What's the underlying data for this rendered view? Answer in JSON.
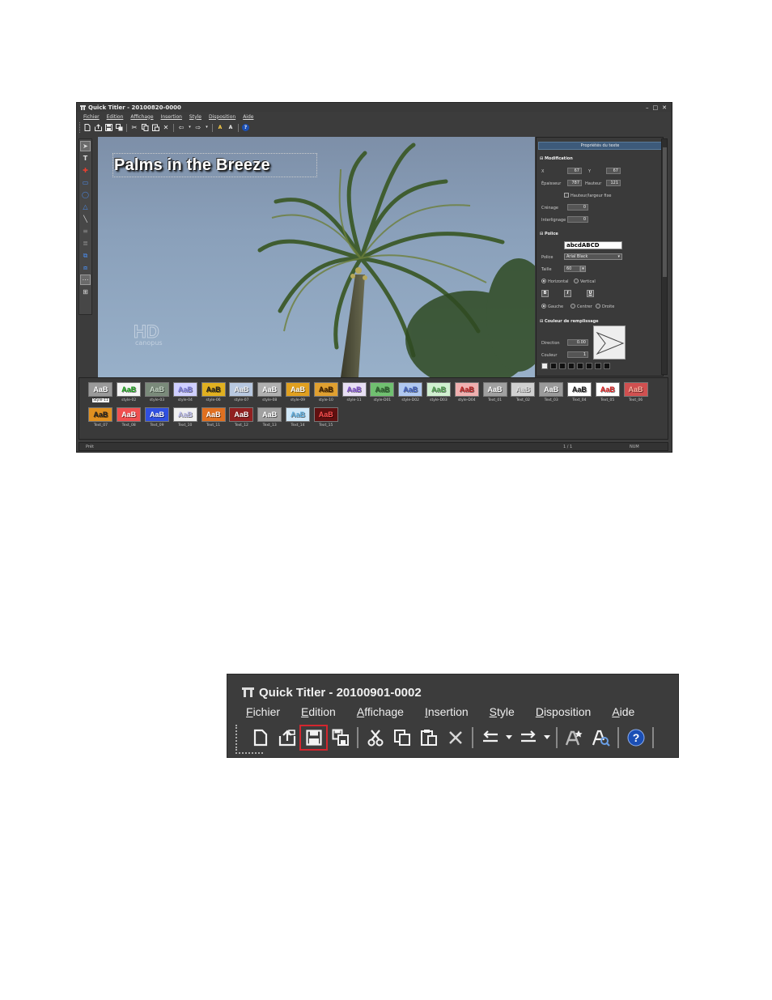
{
  "app": {
    "title": "Quick Titler - 20100820-0000",
    "menus": [
      "Fichier",
      "Edition",
      "Affichage",
      "Insertion",
      "Style",
      "Disposition",
      "Aide"
    ],
    "canvas_text": "Palms in the Breeze",
    "watermark": "HD",
    "watermark_sub": "canopus",
    "props": {
      "header": "Propriétés du texte",
      "sec_modif": "Modification",
      "x_label": "X",
      "x_value": "67",
      "y_label": "Y",
      "y_value": "67",
      "w_label": "Épaisseur",
      "w_value": "787",
      "h_label": "Hauteur",
      "h_value": "121",
      "fixed_label": "Hauteur/largeur fixe",
      "kern_label": "Crénage",
      "kern_value": "0",
      "lead_label": "Interlignage",
      "lead_value": "0",
      "sec_font": "Police",
      "font_preview": "abcdABCD",
      "font_label": "Police",
      "font_value": "Arial Black",
      "size_label": "Taille",
      "size_value": "60",
      "horiz": "Horizontal",
      "vert": "Vertical",
      "bold": "B",
      "italic": "I",
      "underline": "U",
      "align_left": "Gauche",
      "align_center": "Centrer",
      "align_right": "Droite",
      "sec_fill": "Couleur de remplissage",
      "dir_label": "Direction",
      "dir_value": "0.00",
      "color_label": "Couleur",
      "color_value": "1"
    },
    "styles": [
      {
        "label": "Style-11",
        "fg": "#ffffff",
        "bg": "#9a9a9a",
        "selected": true
      },
      {
        "label": "style-02",
        "fg": "#18a018",
        "bg": "#f4f4f4"
      },
      {
        "label": "style-03",
        "fg": "#c8d8c8",
        "bg": "#7a8a7a"
      },
      {
        "label": "style-04",
        "fg": "#8080e0",
        "bg": "#d0d0ff"
      },
      {
        "label": "style-06",
        "fg": "#202020",
        "bg": "#e0b020"
      },
      {
        "label": "style-07",
        "fg": "#f0f0f0",
        "bg": "#b8c8e0"
      },
      {
        "label": "style-08",
        "fg": "#ffffff",
        "bg": "#b0b0b0"
      },
      {
        "label": "style-09",
        "fg": "#ffffff",
        "bg": "#e0a020"
      },
      {
        "label": "style-10",
        "fg": "#402000",
        "bg": "#e0a030"
      },
      {
        "label": "style-11",
        "fg": "#8050d0",
        "bg": "#e8e0f4"
      },
      {
        "label": "style-D01",
        "fg": "#306030",
        "bg": "#70c070"
      },
      {
        "label": "style-D02",
        "fg": "#4060c0",
        "bg": "#b0c8f0"
      },
      {
        "label": "style-D03",
        "fg": "#50a050",
        "bg": "#d0f0d0"
      },
      {
        "label": "style-D04",
        "fg": "#c02020",
        "bg": "#f0b0b0"
      },
      {
        "label": "Text_01",
        "fg": "#ffffff",
        "bg": "#a0a0a0"
      },
      {
        "label": "Text_02",
        "fg": "#e0e0e0",
        "bg": "#d0d0d0"
      },
      {
        "label": "Text_03",
        "fg": "#ffffff",
        "bg": "#9a9a9a"
      },
      {
        "label": "Text_04",
        "fg": "#202020",
        "bg": "#ffffff"
      },
      {
        "label": "Text_05",
        "fg": "#e02020",
        "bg": "#ffffff"
      },
      {
        "label": "Text_06",
        "fg": "#ffb0a0",
        "bg": "#d05050"
      },
      {
        "label": "Text_07",
        "fg": "#202020",
        "bg": "#e09020"
      },
      {
        "label": "Text_08",
        "fg": "#ffffff",
        "bg": "#f05050"
      },
      {
        "label": "Text_09",
        "fg": "#ffffff",
        "bg": "#3050e0"
      },
      {
        "label": "Text_10",
        "fg": "#c0c0f0",
        "bg": "#f0f0f0"
      },
      {
        "label": "Text_11",
        "fg": "#ffffff",
        "bg": "#e07020"
      },
      {
        "label": "Text_12",
        "fg": "#ffffff",
        "bg": "#902020"
      },
      {
        "label": "Text_13",
        "fg": "#ffffff",
        "bg": "#a0a0a0"
      },
      {
        "label": "Text_14",
        "fg": "#60b0e0",
        "bg": "#d0e8f8"
      },
      {
        "label": "Text_15",
        "fg": "#ff5050",
        "bg": "#601010"
      }
    ],
    "status_left": "Prêt",
    "status_page": "1 / 1",
    "status_num": "NUM"
  },
  "zoom": {
    "title": "Quick Titler - 20100901-0002",
    "menus": [
      {
        "u": "F",
        "rest": "ichier"
      },
      {
        "u": "E",
        "rest": "dition"
      },
      {
        "u": "A",
        "rest": "ffichage"
      },
      {
        "u": "I",
        "rest": "nsertion"
      },
      {
        "u": "S",
        "rest": "tyle"
      },
      {
        "u": "D",
        "rest": "isposition"
      },
      {
        "u": "A",
        "rest": "ide"
      }
    ],
    "highlight_color": "#d3262e"
  }
}
